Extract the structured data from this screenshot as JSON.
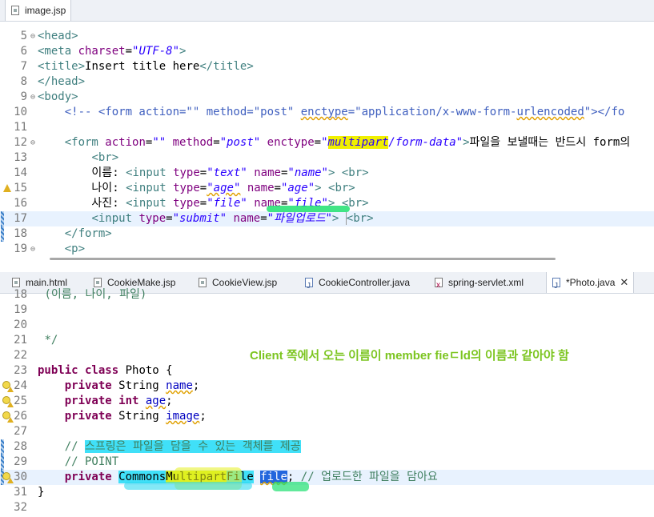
{
  "editor_top": {
    "tab": {
      "label": "image.jsp",
      "icon": "jsp-file-icon"
    },
    "lines": [
      {
        "num": "5",
        "fold": "⊖",
        "html": "<span class=\"tg\">&lt;head&gt;</span>"
      },
      {
        "num": "6",
        "html": "<span class=\"tg\">&lt;meta </span><span class=\"at\">charset</span>=<span class=\"av\">\"UTF-8\"</span><span class=\"tg\">&gt;</span>"
      },
      {
        "num": "7",
        "html": "<span class=\"tg\">&lt;title&gt;</span>Insert title here<span class=\"tg\">&lt;/title&gt;</span>"
      },
      {
        "num": "8",
        "html": "<span class=\"tg\">&lt;/head&gt;</span>"
      },
      {
        "num": "9",
        "fold": "⊖",
        "html": "<span class=\"tg\">&lt;body&gt;</span>"
      },
      {
        "num": "10",
        "html": "    <span class=\"cm\">&lt;!-- &lt;form action=\"\" method=\"post\" <span class=\"sq\">enctype</span>=\"application/x-www-form-<span class=\"sq\">urlencoded</span>\"&gt;&lt;/fo</span>"
      },
      {
        "num": "11",
        "html": ""
      },
      {
        "num": "12",
        "fold": "⊖",
        "html": "    <span class=\"tg\">&lt;form </span><span class=\"at\">action</span>=<span class=\"av\">\"\"</span><span class=\"tg\"> </span><span class=\"at\">method</span>=<span class=\"av\">\"post\"</span><span class=\"tg\"> </span><span class=\"at\">enctype</span>=<span class=\"av\">\"<span style=\"background:#f0f000\">multipart</span>/form-data\"</span><span class=\"tg\">&gt;</span>파일을 보낼때는 반드시 form의"
      },
      {
        "num": "13",
        "html": "        <span class=\"tg\">&lt;br&gt;</span>"
      },
      {
        "num": "14",
        "html": "        이름: <span class=\"tg\">&lt;input </span><span class=\"at\">type</span>=<span class=\"av\">\"text\"</span><span class=\"tg\"> </span><span class=\"at\">name</span>=<span class=\"av\">\"name\"</span><span class=\"tg\">&gt;</span> <span class=\"tg\">&lt;br&gt;</span>"
      },
      {
        "num": "15",
        "mark": "warn",
        "html": "        나이: <span class=\"tg\">&lt;input </span><span class=\"at\">type</span>=<span class=\"av sqr\">\"age\"</span><span class=\"tg\"> </span><span class=\"at\">name</span>=<span class=\"av\">\"age\"</span><span class=\"tg\">&gt;</span> <span class=\"tg\">&lt;br&gt;</span>"
      },
      {
        "num": "16",
        "html": "        사진: <span class=\"tg\">&lt;input </span><span class=\"at\">type</span>=<span class=\"av\">\"file\"</span><span class=\"tg\"> </span><span class=\"at\">name</span>=<span class=\"av\">\"file\"</span><span class=\"tg\">&gt;</span> <span class=\"tg\">&lt;br&gt;</span>"
      },
      {
        "num": "17",
        "mark": "change",
        "cur": true,
        "html": "        <span class=\"tg\">&lt;input </span><span class=\"at\">type</span>=<span class=\"av\">\"submit\"</span><span class=\"tg\"> </span><span class=\"at\">name</span>=<span class=\"av\">\"파일업로드\"</span><span class=\"tg\">&gt;</span> <span class=\"tg\" style=\"border-left:1px solid #999\">&lt;br&gt;</span>"
      },
      {
        "num": "18",
        "mark": "change",
        "html": "    <span class=\"tg\">&lt;/form&gt;</span>"
      },
      {
        "num": "19",
        "fold": "⊖",
        "html": "    <span class=\"tg\">&lt;p&gt;</span>"
      }
    ]
  },
  "editor_bottom": {
    "tabs": [
      {
        "label": "main.html",
        "icon": "html-file-icon",
        "cls": "jsp"
      },
      {
        "label": "CookieMake.jsp",
        "icon": "jsp-file-icon",
        "cls": "jsp"
      },
      {
        "label": "CookieView.jsp",
        "icon": "jsp-file-icon",
        "cls": "jsp"
      },
      {
        "label": "CookieController.java",
        "icon": "java-file-icon",
        "cls": "java"
      },
      {
        "label": "spring-servlet.xml",
        "icon": "xml-file-icon",
        "cls": "xml"
      },
      {
        "label": "*Photo.java",
        "icon": "java-file-icon",
        "cls": "java",
        "active": true,
        "close": "✕"
      }
    ],
    "annotation": "Client 쪽에서 오는 이름이 member fieㄷld의 이름과 같아야 함",
    "lines": [
      {
        "num": "18",
        "html": " <span class=\"jcm\">(이름, 나이, 파일)</span>"
      },
      {
        "num": "19",
        "html": ""
      },
      {
        "num": "20",
        "html": ""
      },
      {
        "num": "21",
        "html": " <span class=\"jcm\">*/</span>"
      },
      {
        "num": "22",
        "html": ""
      },
      {
        "num": "23",
        "html": "<span class=\"kw\">public class</span> Photo {"
      },
      {
        "num": "24",
        "mark": "bulb",
        "html": "    <span class=\"kw\">private</span> String <span class=\"fld sqr\">name</span>;"
      },
      {
        "num": "25",
        "mark": "bulb",
        "html": "    <span class=\"kw\">private int</span> <span class=\"fld sqr\">age</span>;"
      },
      {
        "num": "26",
        "mark": "bulb",
        "html": "    <span class=\"kw\">private</span> String <span class=\"fld sqr\">image</span>;"
      },
      {
        "num": "27",
        "html": ""
      },
      {
        "num": "28",
        "mark": "change",
        "html": "    <span class=\"jcm\">// <span style=\"background:#40e0f8\">스프링은 파일을 담을 수 있는 객체를 제공</span></span>"
      },
      {
        "num": "29",
        "mark": "change",
        "html": "    <span class=\"jcm\">// POINT</span>"
      },
      {
        "num": "30",
        "mark": "bulb-change",
        "cur": true,
        "html": "    <span class=\"kw\">private</span> <span style=\"background:#40e0f8\">Commons<span style=\"background:#d8f020\">Multipart</span>File</span> <span class=\"fld sqr\" style=\"background:#2266dd;color:#fff\">file</span>; <span class=\"jcm\">// 업로드한 파일을 담아요</span>"
      },
      {
        "num": "31",
        "html": "}"
      },
      {
        "num": "32",
        "html": ""
      }
    ]
  }
}
